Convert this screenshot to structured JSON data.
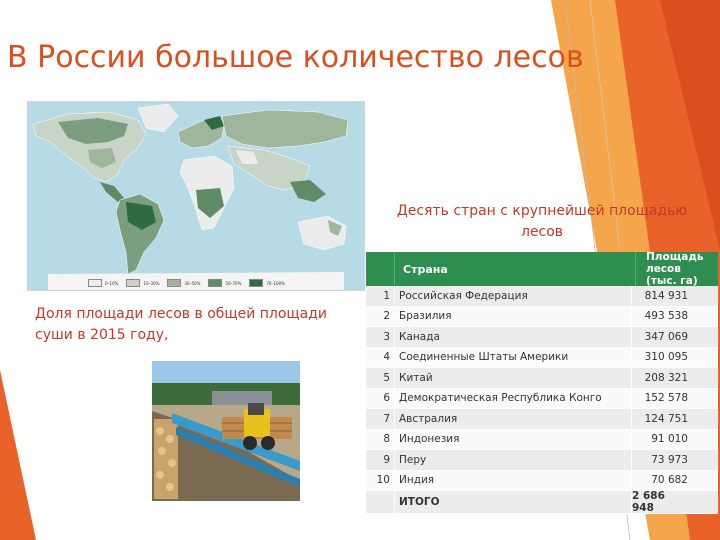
{
  "slide": {
    "title": "В России большое количество лесов",
    "accent_color": "#e8622a",
    "caption_color": "#c0392b"
  },
  "map": {
    "legend": [
      "0–10%",
      "10–30%",
      "30–50%",
      "50–70%",
      "70–100%"
    ],
    "legend_colors": [
      "#ececec",
      "#c8d4c6",
      "#9fb59c",
      "#5e8c66",
      "#2e6b40"
    ]
  },
  "caption": {
    "line1": "Доля площади лесов в общей площади",
    "line2": "суши в 2015 году,"
  },
  "table_title": {
    "line1": "Десять стран с крупнейшей площадью",
    "line2": "лесов"
  },
  "table": {
    "col_country": "Страна",
    "col_area_line1": "Площадь лесов",
    "col_area_line2": "(тыс. га)",
    "rows": [
      {
        "n": "1",
        "country": "Российская Федерация",
        "area": "814 931"
      },
      {
        "n": "2",
        "country": "Бразилия",
        "area": "493 538"
      },
      {
        "n": "3",
        "country": "Канада",
        "area": "347 069"
      },
      {
        "n": "4",
        "country": "Соединенные Штаты Америки",
        "area": "310 095"
      },
      {
        "n": "5",
        "country": "Китай",
        "area": "208 321"
      },
      {
        "n": "6",
        "country": "Демократическая Республика Конго",
        "area": "152 578"
      },
      {
        "n": "7",
        "country": "Австралия",
        "area": "124 751"
      },
      {
        "n": "8",
        "country": "Индонезия",
        "area": "91 010"
      },
      {
        "n": "9",
        "country": "Перу",
        "area": "73 973"
      },
      {
        "n": "10",
        "country": "Индия",
        "area": "70 682"
      }
    ],
    "total_label": "ИТОГО",
    "total_value": "2 686 948",
    "header_color": "#2e8e4f"
  }
}
